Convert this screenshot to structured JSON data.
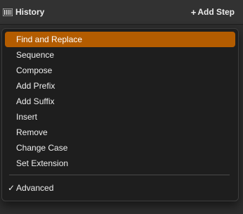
{
  "header": {
    "history_label": "History",
    "history_icon": "history-icon",
    "add_step_label": "Add Step",
    "add_step_icon": "plus-icon"
  },
  "menu": {
    "items": [
      {
        "label": "Find and Replace",
        "selected": true
      },
      {
        "label": "Sequence",
        "selected": false
      },
      {
        "label": "Compose",
        "selected": false
      },
      {
        "label": "Add Prefix",
        "selected": false
      },
      {
        "label": "Add Suffix",
        "selected": false
      },
      {
        "label": "Insert",
        "selected": false
      },
      {
        "label": "Remove",
        "selected": false
      },
      {
        "label": "Change Case",
        "selected": false
      },
      {
        "label": "Set Extension",
        "selected": false
      }
    ],
    "advanced": {
      "label": "Advanced",
      "checked": true,
      "check_glyph": "✓"
    }
  },
  "colors": {
    "accent": "#b35c00"
  }
}
